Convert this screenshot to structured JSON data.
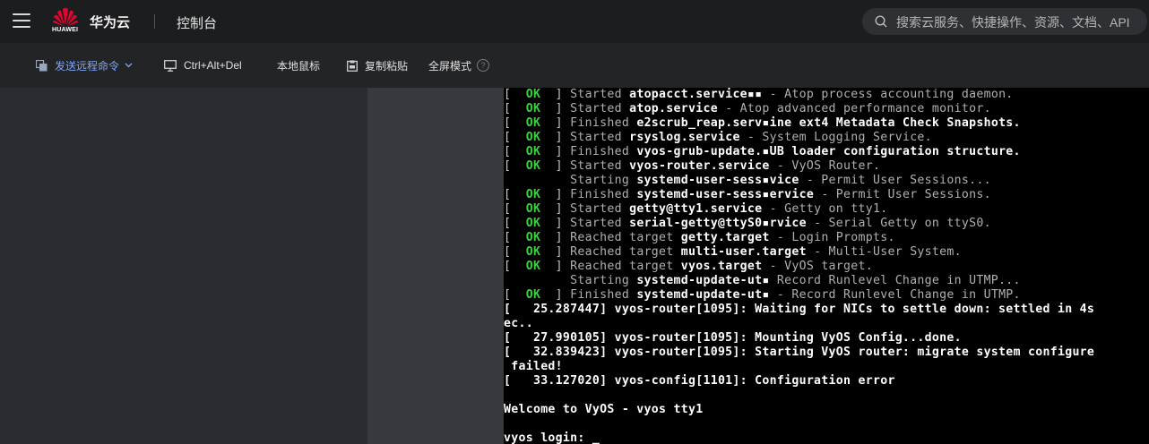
{
  "header": {
    "logo_text": "HUAWEI",
    "brand": "华为云",
    "console": "控制台",
    "search_placeholder": "搜索云服务、快捷操作、资源、文档、API"
  },
  "toolbar": {
    "send_command": "发送远程命令",
    "ctrl_alt_del": "Ctrl+Alt+Del",
    "local_mouse": "本地鼠标",
    "copy_paste": "复制粘贴",
    "fullscreen": "全屏模式",
    "help": "?"
  },
  "terminal": {
    "lines": [
      {
        "kind": "ok",
        "pre": "[  ",
        "status": "OK",
        "mid": "  ] ",
        "verb": "Started ",
        "name": "atopacct.service▪▪",
        "desc": " - Atop process accounting daemon."
      },
      {
        "kind": "ok",
        "pre": "[  ",
        "status": "OK",
        "mid": "  ] ",
        "verb": "Started ",
        "name": "atop.service",
        "desc": " - Atop advanced performance monitor."
      },
      {
        "kind": "ok",
        "pre": "[  ",
        "status": "OK",
        "mid": "  ] ",
        "verb": "Finished ",
        "name": "e2scrub_reap.serv▪ine ext4 Metadata Check Snapshots.",
        "desc": ""
      },
      {
        "kind": "ok",
        "pre": "[  ",
        "status": "OK",
        "mid": "  ] ",
        "verb": "Started ",
        "name": "rsyslog.service",
        "desc": " - System Logging Service."
      },
      {
        "kind": "ok",
        "pre": "[  ",
        "status": "OK",
        "mid": "  ] ",
        "verb": "Finished ",
        "name": "vyos-grub-update.▪UB loader configuration structure.",
        "desc": ""
      },
      {
        "kind": "ok",
        "pre": "[  ",
        "status": "OK",
        "mid": "  ] ",
        "verb": "Started ",
        "name": "vyos-router.service",
        "desc": " - VyOS Router."
      },
      {
        "kind": "start",
        "pre": "         ",
        "verb": "Starting ",
        "name": "systemd-user-sess▪vice",
        "desc": " - Permit User Sessions..."
      },
      {
        "kind": "ok",
        "pre": "[  ",
        "status": "OK",
        "mid": "  ] ",
        "verb": "Finished ",
        "name": "systemd-user-sess▪ervice",
        "desc": " - Permit User Sessions."
      },
      {
        "kind": "ok",
        "pre": "[  ",
        "status": "OK",
        "mid": "  ] ",
        "verb": "Started ",
        "name": "getty@tty1.service",
        "desc": " - Getty on tty1."
      },
      {
        "kind": "ok",
        "pre": "[  ",
        "status": "OK",
        "mid": "  ] ",
        "verb": "Started ",
        "name": "serial-getty@ttyS0▪rvice",
        "desc": " - Serial Getty on ttyS0."
      },
      {
        "kind": "ok",
        "pre": "[  ",
        "status": "OK",
        "mid": "  ] ",
        "verb": "Reached target ",
        "name": "getty.target",
        "desc": " - Login Prompts."
      },
      {
        "kind": "ok",
        "pre": "[  ",
        "status": "OK",
        "mid": "  ] ",
        "verb": "Reached target ",
        "name": "multi-user.target",
        "desc": " - Multi-User System."
      },
      {
        "kind": "ok",
        "pre": "[  ",
        "status": "OK",
        "mid": "  ] ",
        "verb": "Reached target ",
        "name": "vyos.target",
        "desc": " - VyOS target."
      },
      {
        "kind": "start",
        "pre": "         ",
        "verb": "Starting ",
        "name": "systemd-update-ut▪",
        "desc": " Record Runlevel Change in UTMP..."
      },
      {
        "kind": "ok",
        "pre": "[  ",
        "status": "OK",
        "mid": "  ] ",
        "verb": "Finished ",
        "name": "systemd-update-ut▪",
        "desc": " - Record Runlevel Change in UTMP."
      },
      {
        "kind": "plain",
        "text": "[   25.287447] vyos-router[1095]: Waiting for NICs to settle down: settled in 4s"
      },
      {
        "kind": "plain",
        "text": "ec.."
      },
      {
        "kind": "plain",
        "text": "[   27.990105] vyos-router[1095]: Mounting VyOS Config...done."
      },
      {
        "kind": "plain",
        "text": "[   32.839423] vyos-router[1095]: Starting VyOS router: migrate system configure"
      },
      {
        "kind": "plain",
        "text": " failed!"
      },
      {
        "kind": "plain",
        "text": "[   33.127020] vyos-config[1101]: Configuration error"
      },
      {
        "kind": "plain",
        "text": ""
      },
      {
        "kind": "plain",
        "text": "Welcome to VyOS - vyos tty1"
      },
      {
        "kind": "plain",
        "text": ""
      },
      {
        "kind": "plain",
        "text": "vyos login: _"
      }
    ]
  }
}
